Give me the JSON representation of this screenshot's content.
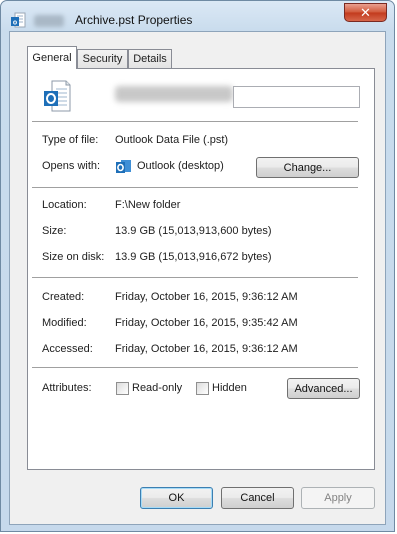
{
  "window": {
    "title": "Archive.pst Properties",
    "close_glyph": "✕"
  },
  "tabs": [
    {
      "label": "General",
      "active": true
    },
    {
      "label": "Security",
      "active": false
    },
    {
      "label": "Details",
      "active": false
    }
  ],
  "general": {
    "type_label": "Type of file:",
    "type_value": "Outlook Data File (.pst)",
    "opens_label": "Opens with:",
    "opens_value": "Outlook (desktop)",
    "change_button": "Change...",
    "location_label": "Location:",
    "location_value": "F:\\New folder",
    "size_label": "Size:",
    "size_value": "13.9 GB (15,013,913,600 bytes)",
    "size_disk_label": "Size on disk:",
    "size_disk_value": "13.9 GB (15,013,916,672 bytes)",
    "created_label": "Created:",
    "created_value": "Friday, October 16, 2015, 9:36:12 AM",
    "modified_label": "Modified:",
    "modified_value": "Friday, October 16, 2015, 9:35:42 AM",
    "accessed_label": "Accessed:",
    "accessed_value": "Friday, October 16, 2015, 9:36:12 AM",
    "attributes_label": "Attributes:",
    "readonly_label": "Read-only",
    "readonly_checked": false,
    "hidden_label": "Hidden",
    "hidden_checked": false,
    "advanced_button": "Advanced..."
  },
  "footer": {
    "ok": "OK",
    "cancel": "Cancel",
    "apply": "Apply"
  },
  "icons": {
    "file": "outlook-data-file-icon",
    "app": "outlook-icon"
  },
  "colors": {
    "outlook_blue": "#1e6fb8",
    "close_red": "#c7432a"
  }
}
